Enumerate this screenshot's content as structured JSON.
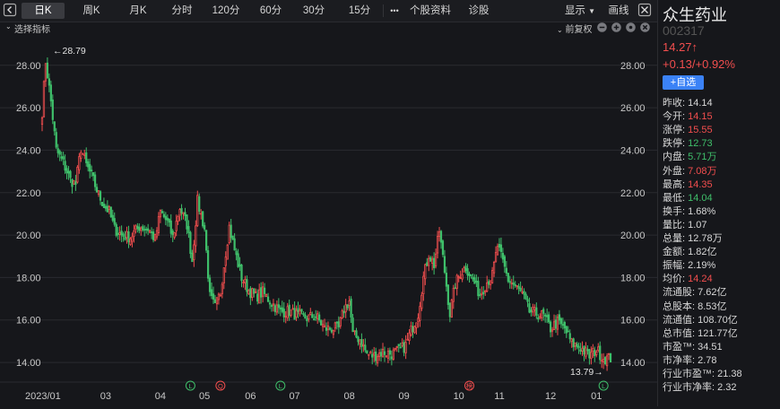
{
  "toolbar": {
    "tabs": [
      "日K",
      "周K",
      "月K",
      "分时",
      "120分",
      "60分",
      "30分",
      "15分"
    ],
    "more": "•••",
    "stock_info": "个股资料",
    "diagnose": "诊股",
    "display": "显示",
    "drawline": "画线"
  },
  "subbar": {
    "indicator": "选择指标",
    "adjust": "前复权"
  },
  "stock": {
    "name": "众生药业",
    "code": "002317",
    "price": "14.27↑",
    "change": "+0.13/+0.92%",
    "add_watch": "+自选"
  },
  "quote": [
    {
      "label": "昨收:",
      "value": "14.14",
      "color": "nc"
    },
    {
      "label": "今开:",
      "value": "14.15",
      "color": "up"
    },
    {
      "label": "涨停:",
      "value": "15.55",
      "color": "up"
    },
    {
      "label": "跌停:",
      "value": "12.73",
      "color": "dn"
    },
    {
      "label": "内盘:",
      "value": "5.71万",
      "color": "dn"
    },
    {
      "label": "外盘:",
      "value": "7.08万",
      "color": "up"
    },
    {
      "label": "最高:",
      "value": "14.35",
      "color": "up"
    },
    {
      "label": "最低:",
      "value": "14.04",
      "color": "dn"
    },
    {
      "label": "换手:",
      "value": "1.68%",
      "color": "nc"
    },
    {
      "label": "量比:",
      "value": "1.07",
      "color": "nc"
    },
    {
      "label": "总量:",
      "value": "12.78万",
      "color": "nc"
    },
    {
      "label": "金额:",
      "value": "1.82亿",
      "color": "nc"
    },
    {
      "label": "振幅:",
      "value": "2.19%",
      "color": "nc"
    },
    {
      "label": "均价:",
      "value": "14.24",
      "color": "up"
    },
    {
      "label": "流通股:",
      "value": "7.62亿",
      "color": "nc"
    },
    {
      "label": "总股本:",
      "value": "8.53亿",
      "color": "nc"
    },
    {
      "label": "流通值:",
      "value": "108.70亿",
      "color": "nc"
    },
    {
      "label": "总市值:",
      "value": "121.77亿",
      "color": "nc"
    },
    {
      "label": "市盈™:",
      "value": "34.51",
      "color": "nc"
    },
    {
      "label": "市净率:",
      "value": "2.78",
      "color": "nc"
    },
    {
      "label": "行业市盈™:",
      "value": "21.38",
      "color": "nc"
    },
    {
      "label": "行业市净率:",
      "value": "2.32",
      "color": "nc"
    }
  ],
  "colors": {
    "up": "#f24e4e",
    "down": "#3fbf6a",
    "grid": "#2a2b30",
    "accent": "#3b82f6"
  },
  "chart_data": {
    "type": "candlestick",
    "y_ticks": [
      "28.00",
      "26.00",
      "24.00",
      "22.00",
      "20.00",
      "18.00",
      "16.00",
      "14.00"
    ],
    "ylim": [
      13.2,
      29.3
    ],
    "x_ticks": [
      {
        "label": "2023/01",
        "i": 0
      },
      {
        "label": "03",
        "i": 36
      },
      {
        "label": "04",
        "i": 67
      },
      {
        "label": "05",
        "i": 92
      },
      {
        "label": "06",
        "i": 118
      },
      {
        "label": "07",
        "i": 143
      },
      {
        "label": "08",
        "i": 174
      },
      {
        "label": "09",
        "i": 205
      },
      {
        "label": "10",
        "i": 236
      },
      {
        "label": "11",
        "i": 259
      },
      {
        "label": "12",
        "i": 288
      },
      {
        "label": "01",
        "i": 314
      }
    ],
    "max_label": "←28.79",
    "min_label": "13.79→",
    "marker_events": [
      {
        "i": 84,
        "label": "L",
        "type": "dn"
      },
      {
        "i": 101,
        "label": "Q",
        "type": "up"
      },
      {
        "i": 135,
        "label": "L",
        "type": "dn"
      },
      {
        "i": 242,
        "label": "榜",
        "type": "up"
      },
      {
        "i": 318,
        "label": "L",
        "type": "dn"
      }
    ],
    "closes_anchor": [
      [
        0,
        25.8
      ],
      [
        2,
        28.2
      ],
      [
        5,
        26.3
      ],
      [
        8,
        24.0
      ],
      [
        12,
        23.4
      ],
      [
        16,
        22.6
      ],
      [
        19,
        22.4
      ],
      [
        22,
        24.1
      ],
      [
        25,
        23.3
      ],
      [
        28,
        22.8
      ],
      [
        32,
        21.9
      ],
      [
        35,
        21.4
      ],
      [
        38,
        21.1
      ],
      [
        41,
        20.3
      ],
      [
        45,
        20.0
      ],
      [
        50,
        19.9
      ],
      [
        55,
        20.4
      ],
      [
        60,
        20.3
      ],
      [
        64,
        19.8
      ],
      [
        67,
        21.1
      ],
      [
        71,
        20.6
      ],
      [
        74,
        19.9
      ],
      [
        78,
        21.3
      ],
      [
        82,
        20.5
      ],
      [
        85,
        18.8
      ],
      [
        88,
        21.6
      ],
      [
        92,
        20.3
      ],
      [
        95,
        17.1
      ],
      [
        98,
        16.6
      ],
      [
        101,
        17.3
      ],
      [
        103,
        18.6
      ],
      [
        106,
        20.4
      ],
      [
        109,
        19.3
      ],
      [
        113,
        18.0
      ],
      [
        117,
        17.4
      ],
      [
        121,
        17.1
      ],
      [
        125,
        17.3
      ],
      [
        130,
        16.8
      ],
      [
        135,
        16.4
      ],
      [
        140,
        16.4
      ],
      [
        145,
        16.2
      ],
      [
        150,
        16.1
      ],
      [
        155,
        16.2
      ],
      [
        160,
        15.6
      ],
      [
        165,
        15.6
      ],
      [
        168,
        15.6
      ],
      [
        171,
        16.5
      ],
      [
        174,
        16.9
      ],
      [
        176,
        15.3
      ],
      [
        180,
        15.1
      ],
      [
        184,
        14.4
      ],
      [
        188,
        14.3
      ],
      [
        193,
        14.5
      ],
      [
        198,
        14.4
      ],
      [
        203,
        14.6
      ],
      [
        206,
        14.8
      ],
      [
        209,
        15.5
      ],
      [
        213,
        16.3
      ],
      [
        216,
        18.0
      ],
      [
        219,
        19.1
      ],
      [
        222,
        18.6
      ],
      [
        225,
        20.2
      ],
      [
        228,
        18.3
      ],
      [
        231,
        16.3
      ],
      [
        234,
        17.7
      ],
      [
        237,
        18.2
      ],
      [
        240,
        18.5
      ],
      [
        244,
        17.9
      ],
      [
        248,
        17.2
      ],
      [
        252,
        17.8
      ],
      [
        255,
        18.1
      ],
      [
        258,
        19.5
      ],
      [
        261,
        18.7
      ],
      [
        264,
        17.9
      ],
      [
        268,
        17.6
      ],
      [
        272,
        17.2
      ],
      [
        276,
        16.4
      ],
      [
        280,
        16.3
      ],
      [
        284,
        16.2
      ],
      [
        288,
        15.6
      ],
      [
        292,
        15.9
      ],
      [
        296,
        15.6
      ],
      [
        300,
        14.9
      ],
      [
        305,
        14.7
      ],
      [
        310,
        14.3
      ],
      [
        314,
        14.6
      ],
      [
        318,
        14.2
      ]
    ]
  }
}
